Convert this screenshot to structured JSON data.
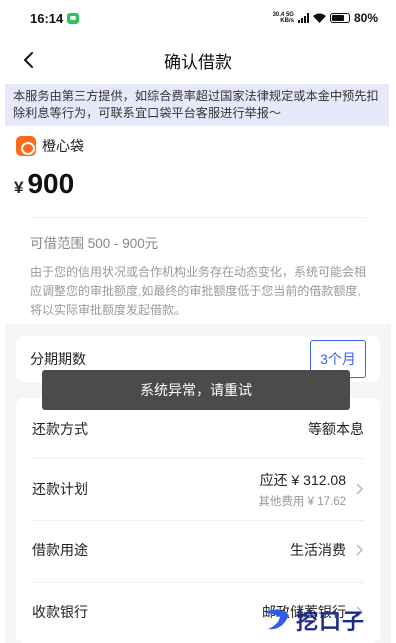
{
  "status_bar": {
    "time": "16:14",
    "network_speed": "30.4",
    "network_unit": "KB/s",
    "network_type": "5G",
    "battery": "80%"
  },
  "header": {
    "title": "确认借款"
  },
  "notice": {
    "text": "本服务由第三方提供，如综合费率超过国家法律规定或本金中预先扣除利息等行为，可联系宜口袋平台客服进行举报～"
  },
  "lender": {
    "name": "橙心袋"
  },
  "loan": {
    "currency": "¥",
    "amount": "900",
    "range_text": "可借范围 500 - 900元",
    "explanation": "由于您的信用状况或合作机构业务存在动态变化，系统可能会相应调整您的审批额度,如最终的审批额度低于您当前的借款额度,将以实际审批额度发起借款。"
  },
  "installment": {
    "label": "分期期数",
    "selected": "3个月"
  },
  "rows": {
    "repay_method": {
      "label": "还款方式",
      "value": "等额本息"
    },
    "repay_plan": {
      "label": "还款计划",
      "value": "应还 ¥ 312.08",
      "sub": "其他费用 ¥ 17.62"
    },
    "purpose": {
      "label": "借款用途",
      "value": "生活消费"
    },
    "bank": {
      "label": "收款银行",
      "value": "邮政储蓄银行"
    }
  },
  "toast": {
    "text": "系统异常，请重试"
  },
  "watermark": {
    "text": "挖口子"
  },
  "colors": {
    "accent": "#3b63f0",
    "notice_bg": "#e7e9fb",
    "brand": "#ff6a1a",
    "toast_bg": "#4b4b4b"
  }
}
